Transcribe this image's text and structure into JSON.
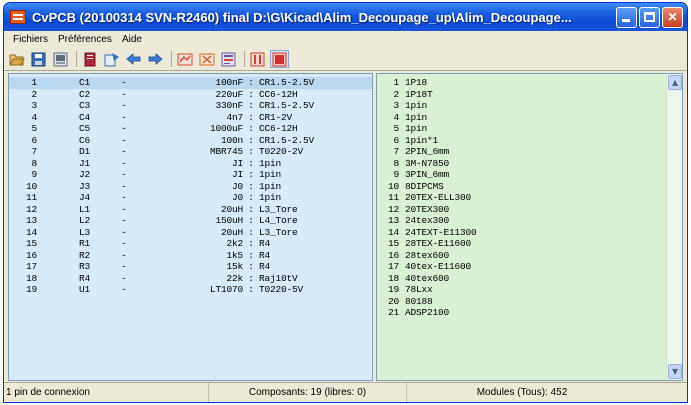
{
  "window": {
    "title": "CvPCB (20100314 SVN-R2460) final D:\\G\\Kicad\\Alim_Decoupage_up\\Alim_Decoupage...",
    "controls": [
      "minimize",
      "maximize",
      "close"
    ]
  },
  "menu": [
    "Fichiers",
    "Préférences",
    "Aide"
  ],
  "toolbar": [
    {
      "name": "open-icon",
      "color": "#d9a441"
    },
    {
      "name": "save-icon",
      "color": "#3a6fc0"
    },
    {
      "name": "config-icon",
      "color": "#5f6b7a"
    },
    {
      "name": "list-icon",
      "color": "#b3263a"
    },
    {
      "name": "module-icon",
      "color": "#3b6fb3"
    },
    {
      "name": "arrow-left-icon",
      "color": "#3d7bd6"
    },
    {
      "name": "arrow-right-icon",
      "color": "#3d7bd6"
    },
    {
      "name": "auto-associate-icon",
      "color": "#d04a34"
    },
    {
      "name": "delete-association-icon",
      "color": "#d2662c"
    },
    {
      "name": "export-icon",
      "color": "#6c5a9e"
    },
    {
      "name": "filter-icon",
      "color": "#c84433"
    },
    {
      "name": "filter-active-icon",
      "color": "#d13030"
    }
  ],
  "components": [
    {
      "num": "1",
      "ref": "C1",
      "value": "100nF",
      "module": "CR1.5-2.5V"
    },
    {
      "num": "2",
      "ref": "C2",
      "value": "220uF",
      "module": "CC6-12H"
    },
    {
      "num": "3",
      "ref": "C3",
      "value": "330nF",
      "module": "CR1.5-2.5V"
    },
    {
      "num": "4",
      "ref": "C4",
      "value": "4n7",
      "module": "CR1-2V"
    },
    {
      "num": "5",
      "ref": "C5",
      "value": "1000uF",
      "module": "CC6-12H"
    },
    {
      "num": "6",
      "ref": "C6",
      "value": "100n",
      "module": "CR1.5-2.5V"
    },
    {
      "num": "7",
      "ref": "D1",
      "value": "MBR745",
      "module": "T0220-2V"
    },
    {
      "num": "8",
      "ref": "J1",
      "value": "JI",
      "module": "1pin"
    },
    {
      "num": "9",
      "ref": "J2",
      "value": "JI",
      "module": "1pin"
    },
    {
      "num": "10",
      "ref": "J3",
      "value": "J0",
      "module": "1pin"
    },
    {
      "num": "11",
      "ref": "J4",
      "value": "J0",
      "module": "1pin"
    },
    {
      "num": "12",
      "ref": "L1",
      "value": "20uH",
      "module": "L3_Tore"
    },
    {
      "num": "13",
      "ref": "L2",
      "value": "150uH",
      "module": "L4_Tore"
    },
    {
      "num": "14",
      "ref": "L3",
      "value": "20uH",
      "module": "L3_Tore"
    },
    {
      "num": "15",
      "ref": "R1",
      "value": "2k2",
      "module": "R4"
    },
    {
      "num": "16",
      "ref": "R2",
      "value": "1k5",
      "module": "R4"
    },
    {
      "num": "17",
      "ref": "R3",
      "value": "15k",
      "module": "R4"
    },
    {
      "num": "18",
      "ref": "R4",
      "value": "22k",
      "module": "Raj10tV"
    },
    {
      "num": "19",
      "ref": "U1",
      "value": "LT1070",
      "module": "T0220-5V"
    }
  ],
  "modules": [
    {
      "num": "1",
      "name": "1P18"
    },
    {
      "num": "2",
      "name": "1P18T"
    },
    {
      "num": "3",
      "name": "1pin"
    },
    {
      "num": "4",
      "name": "1pin"
    },
    {
      "num": "5",
      "name": "1pin"
    },
    {
      "num": "6",
      "name": "1pin*1"
    },
    {
      "num": "7",
      "name": "2PIN_6mm"
    },
    {
      "num": "8",
      "name": "3M-N7850"
    },
    {
      "num": "9",
      "name": "3PIN_6mm"
    },
    {
      "num": "10",
      "name": "8DIPCMS"
    },
    {
      "num": "11",
      "name": "20TEX-ELL300"
    },
    {
      "num": "12",
      "name": "20TEX300"
    },
    {
      "num": "13",
      "name": "24tex300"
    },
    {
      "num": "14",
      "name": "24TEXT-E11300"
    },
    {
      "num": "15",
      "name": "28TEX-E11600"
    },
    {
      "num": "16",
      "name": "28tex600"
    },
    {
      "num": "17",
      "name": "40tex-E11600"
    },
    {
      "num": "18",
      "name": "40tex600"
    },
    {
      "num": "19",
      "name": "78Lxx"
    },
    {
      "num": "20",
      "name": "80188"
    },
    {
      "num": "21",
      "name": "ADSP2100"
    }
  ],
  "status": {
    "left": "1 pin de connexion",
    "middle": "Composants: 19 (libres: 0)",
    "right": "Modules (Tous): 452"
  },
  "colors": {
    "left_pane": "#d6ebf7",
    "right_pane": "#d9f0d5",
    "titlebar": "#1c5fe0"
  }
}
